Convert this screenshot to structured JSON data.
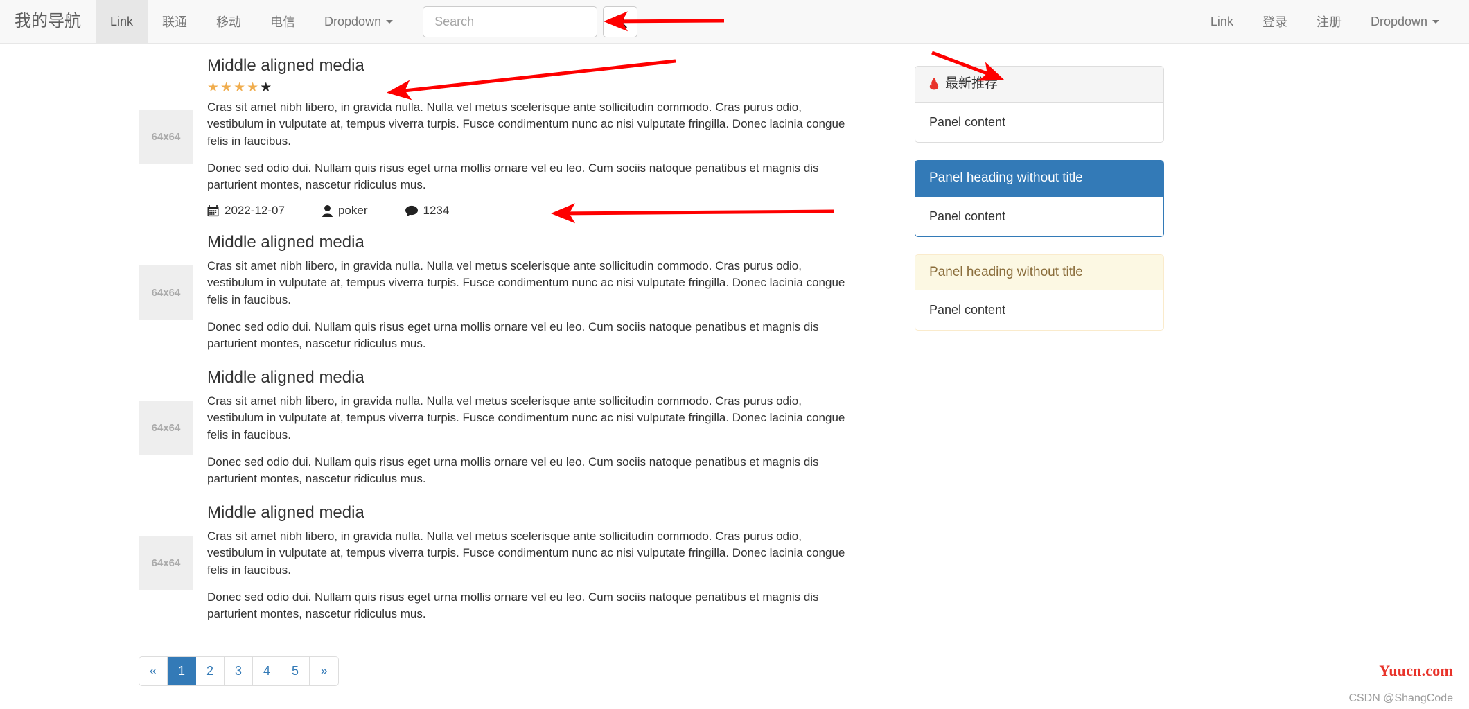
{
  "navbar": {
    "brand": "我的导航",
    "left_items": [
      {
        "label": "Link",
        "active": true,
        "caret": false
      },
      {
        "label": "联通",
        "active": false,
        "caret": false
      },
      {
        "label": "移动",
        "active": false,
        "caret": false
      },
      {
        "label": "电信",
        "active": false,
        "caret": false
      },
      {
        "label": "Dropdown",
        "active": false,
        "caret": true
      }
    ],
    "search": {
      "placeholder": "Search",
      "value": "",
      "button_icon": "search-icon"
    },
    "right_items": [
      {
        "label": "Link",
        "caret": false
      },
      {
        "label": "登录",
        "caret": false
      },
      {
        "label": "注册",
        "caret": false
      },
      {
        "label": "Dropdown",
        "caret": true
      }
    ]
  },
  "media_items": [
    {
      "thumb": "64x64",
      "heading": "Middle aligned media",
      "rating": {
        "filled": 4,
        "total": 5,
        "filled_color": "#f0ad4e",
        "empty_color": "#222222"
      },
      "paragraph1": "Cras sit amet nibh libero, in gravida nulla. Nulla vel metus scelerisque ante sollicitudin commodo. Cras purus odio, vestibulum in vulputate at, tempus viverra turpis. Fusce condimentum nunc ac nisi vulputate fringilla. Donec lacinia congue felis in faucibus.",
      "paragraph2": "Donec sed odio dui. Nullam quis risus eget urna mollis ornare vel eu leo. Cum sociis natoque penatibus et magnis dis parturient montes, nascetur ridiculus mus.",
      "meta": {
        "date": "2022-12-07",
        "author": "poker",
        "comments": "1234"
      }
    },
    {
      "thumb": "64x64",
      "heading": "Middle aligned media",
      "paragraph1": "Cras sit amet nibh libero, in gravida nulla. Nulla vel metus scelerisque ante sollicitudin commodo. Cras purus odio, vestibulum in vulputate at, tempus viverra turpis. Fusce condimentum nunc ac nisi vulputate fringilla. Donec lacinia congue felis in faucibus.",
      "paragraph2": "Donec sed odio dui. Nullam quis risus eget urna mollis ornare vel eu leo. Cum sociis natoque penatibus et magnis dis parturient montes, nascetur ridiculus mus."
    },
    {
      "thumb": "64x64",
      "heading": "Middle aligned media",
      "paragraph1": "Cras sit amet nibh libero, in gravida nulla. Nulla vel metus scelerisque ante sollicitudin commodo. Cras purus odio, vestibulum in vulputate at, tempus viverra turpis. Fusce condimentum nunc ac nisi vulputate fringilla. Donec lacinia congue felis in faucibus.",
      "paragraph2": "Donec sed odio dui. Nullam quis risus eget urna mollis ornare vel eu leo. Cum sociis natoque penatibus et magnis dis parturient montes, nascetur ridiculus mus."
    },
    {
      "thumb": "64x64",
      "heading": "Middle aligned media",
      "paragraph1": "Cras sit amet nibh libero, in gravida nulla. Nulla vel metus scelerisque ante sollicitudin commodo. Cras purus odio, vestibulum in vulputate at, tempus viverra turpis. Fusce condimentum nunc ac nisi vulputate fringilla. Donec lacinia congue felis in faucibus.",
      "paragraph2": "Donec sed odio dui. Nullam quis risus eget urna mollis ornare vel eu leo. Cum sociis natoque penatibus et magnis dis parturient montes, nascetur ridiculus mus."
    }
  ],
  "pagination": {
    "prev": "«",
    "next": "»",
    "pages": [
      "1",
      "2",
      "3",
      "4",
      "5"
    ],
    "active": "1",
    "active_color": "#337ab7"
  },
  "panels": [
    {
      "style": "default",
      "icon": "fire-icon",
      "heading": "最新推荐",
      "body": "Panel content"
    },
    {
      "style": "primary",
      "heading": "Panel heading without title",
      "body": "Panel content",
      "color": "#337ab7"
    },
    {
      "style": "warning",
      "heading": "Panel heading without title",
      "body": "Panel content",
      "color": "#fcf8e3"
    }
  ],
  "watermarks": {
    "brand": "Yuucn.com",
    "brand_color": "#e8332a",
    "credit": "CSDN @ShangCode"
  },
  "annotation_color": "#fe0000"
}
